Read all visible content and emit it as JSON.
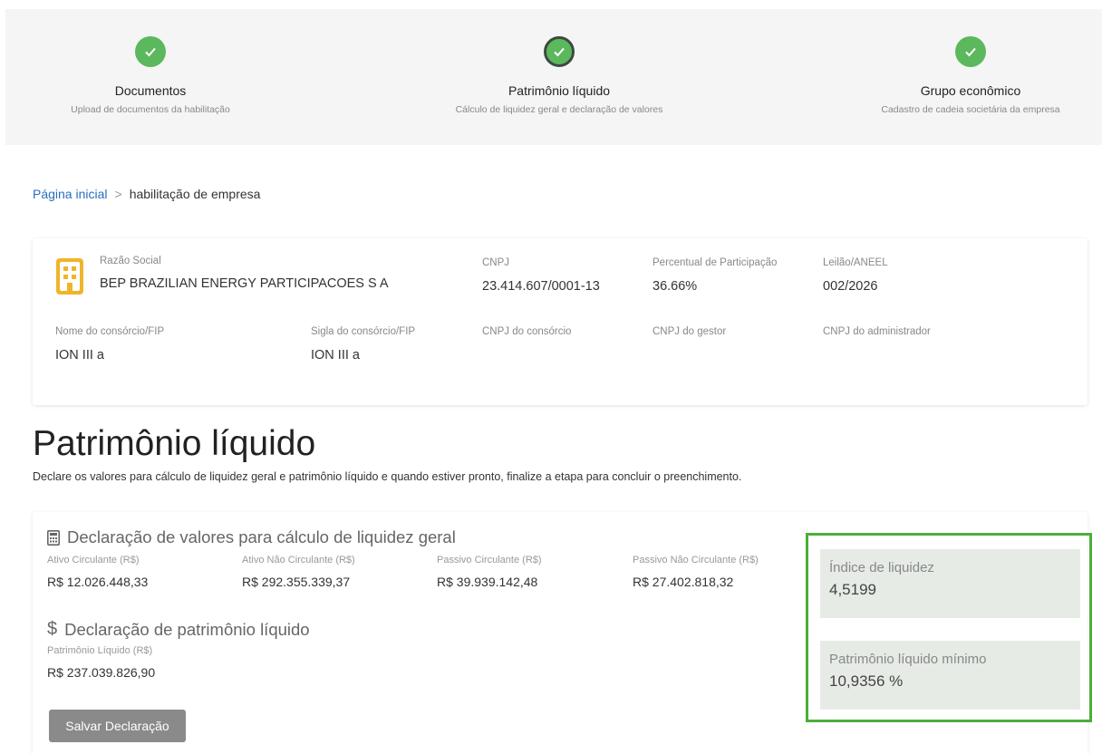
{
  "stepper": {
    "steps": [
      {
        "title": "Documentos",
        "subtitle": "Upload de documentos da habilitação"
      },
      {
        "title": "Patrimônio líquido",
        "subtitle": "Cálculo de liquidez geral e declaração de valores"
      },
      {
        "title": "Grupo econômico",
        "subtitle": "Cadastro de cadeia societária da empresa"
      }
    ]
  },
  "breadcrumb": {
    "home": "Página inicial",
    "separator": ">",
    "current": "habilitação de empresa"
  },
  "company": {
    "razao_social_label": "Razão Social",
    "razao_social": "BEP BRAZILIAN ENERGY PARTICIPACOES S A",
    "cnpj_label": "CNPJ",
    "cnpj": "23.414.607/0001-13",
    "percentual_label": "Percentual de Participação",
    "percentual": "36.66%",
    "leilao_label": "Leilão/ANEEL",
    "leilao": "002/2026",
    "consorcio_nome_label": "Nome do consórcio/FIP",
    "consorcio_nome": "ION III a",
    "consorcio_sigla_label": "Sigla do consórcio/FIP",
    "consorcio_sigla": "ION III a",
    "cnpj_consorcio_label": "CNPJ do consórcio",
    "cnpj_gestor_label": "CNPJ do gestor",
    "cnpj_admin_label": "CNPJ do administrador"
  },
  "page": {
    "title": "Patrimônio líquido",
    "description": "Declare os valores para cálculo de liquidez geral e patrimônio líquido e quando estiver pronto, finalize a etapa para concluir o preenchimento."
  },
  "liquidez": {
    "title": "Declaração de valores para cálculo de liquidez geral",
    "fields": [
      {
        "label": "Ativo Circulante (R$)",
        "value": "R$ 12.026.448,33"
      },
      {
        "label": "Ativo Não Circulante (R$)",
        "value": "R$ 292.355.339,37"
      },
      {
        "label": "Passivo Circulante (R$)",
        "value": "R$ 39.939.142,48"
      },
      {
        "label": "Passivo Não Circulante (R$)",
        "value": "R$ 27.402.818,32"
      }
    ]
  },
  "patrimonio": {
    "title": "Declaração de patrimônio líquido",
    "label": "Patrimônio Líquido (R$)",
    "value": "R$ 237.039.826,90"
  },
  "save_button": "Salvar Declaração",
  "kpis": [
    {
      "label": "Índice de liquidez",
      "value": "4,5199"
    },
    {
      "label": "Patrimônio líquido mínimo",
      "value": "10,9356 %"
    }
  ],
  "colors": {
    "success": "#5cb85c",
    "highlight": "#4cae3a",
    "link": "#2a6ebb",
    "building_icon": "#f0b429"
  }
}
